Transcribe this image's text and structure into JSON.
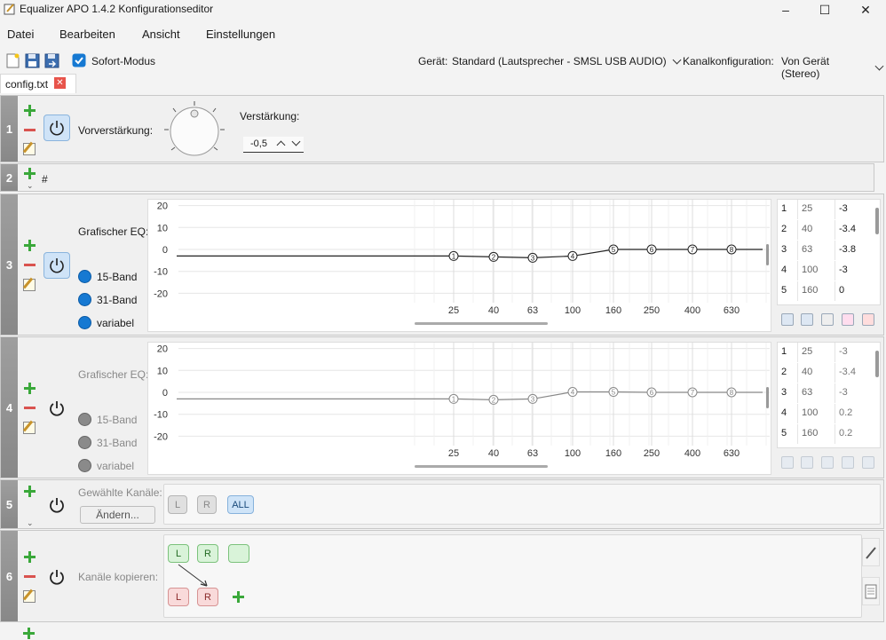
{
  "window": {
    "title": "Equalizer APO 1.4.2 Konfigurationseditor",
    "minimize": "–",
    "maximize": "☐",
    "close": "✕"
  },
  "menu": [
    "Datei",
    "Bearbeiten",
    "Ansicht",
    "Einstellungen"
  ],
  "toolbar": {
    "instant_mode": "Sofort-Modus",
    "device_label": "Gerät:",
    "device_value": "Standard (Lautsprecher - SMSL USB AUDIO)",
    "channel_label": "Kanalkonfiguration:",
    "channel_value": "Von Gerät (Stereo)"
  },
  "tab": {
    "label": "config.txt",
    "close": "✕"
  },
  "rows": {
    "r1": {
      "num": "1",
      "label": "Vorverstärkung:",
      "gain_label": "Verstärkung:",
      "gain_value": "-0,5"
    },
    "r2": {
      "num": "2",
      "text": "#"
    },
    "r3": {
      "num": "3",
      "label": "Grafischer EQ:",
      "opt1": "15-Band",
      "opt2": "31-Band",
      "opt3": "variabel"
    },
    "r4": {
      "num": "4",
      "label": "Grafischer EQ:",
      "opt1": "15-Band",
      "opt2": "31-Band",
      "opt3": "variabel"
    },
    "r5": {
      "num": "5",
      "label": "Gewählte Kanäle:",
      "change": "Ändern...",
      "ch_l": "L",
      "ch_r": "R",
      "ch_all": "ALL"
    },
    "r6": {
      "num": "6",
      "label": "Kanäle kopieren:",
      "src_l": "L",
      "src_r": "R",
      "dst_l": "L",
      "dst_r": "R"
    }
  },
  "eq_axes": {
    "y_ticks": [
      "20",
      "10",
      "0",
      "-10",
      "-20"
    ],
    "x_ticks": [
      "25",
      "40",
      "63",
      "100",
      "160",
      "250",
      "400",
      "630"
    ]
  },
  "eq3": {
    "points": [
      {
        "n": "1",
        "freq": 25,
        "gain": -3
      },
      {
        "n": "2",
        "freq": 40,
        "gain": -3.4
      },
      {
        "n": "3",
        "freq": 63,
        "gain": -3.8
      },
      {
        "n": "4",
        "freq": 100,
        "gain": -3
      },
      {
        "n": "5",
        "freq": 160,
        "gain": 0
      },
      {
        "n": "6",
        "freq": 250,
        "gain": 0
      },
      {
        "n": "7",
        "freq": 400,
        "gain": 0
      },
      {
        "n": "8",
        "freq": 630,
        "gain": 0
      }
    ],
    "table": [
      {
        "n": "1",
        "f": "25",
        "g": "-3"
      },
      {
        "n": "2",
        "f": "40",
        "g": "-3.4"
      },
      {
        "n": "3",
        "f": "63",
        "g": "-3.8"
      },
      {
        "n": "4",
        "f": "100",
        "g": "-3"
      },
      {
        "n": "5",
        "f": "160",
        "g": "0"
      }
    ]
  },
  "eq4": {
    "points": [
      {
        "n": "1",
        "freq": 25,
        "gain": -3
      },
      {
        "n": "2",
        "freq": 40,
        "gain": -3.4
      },
      {
        "n": "3",
        "freq": 63,
        "gain": -3
      },
      {
        "n": "4",
        "freq": 100,
        "gain": 0.2
      },
      {
        "n": "5",
        "freq": 160,
        "gain": 0.2
      },
      {
        "n": "6",
        "freq": 250,
        "gain": 0
      },
      {
        "n": "7",
        "freq": 400,
        "gain": 0
      },
      {
        "n": "8",
        "freq": 630,
        "gain": 0
      }
    ],
    "table": [
      {
        "n": "1",
        "f": "25",
        "g": "-3"
      },
      {
        "n": "2",
        "f": "40",
        "g": "-3.4"
      },
      {
        "n": "3",
        "f": "63",
        "g": "-3"
      },
      {
        "n": "4",
        "f": "100",
        "g": "0.2"
      },
      {
        "n": "5",
        "f": "160",
        "g": "0.2"
      }
    ]
  },
  "colors": {
    "accent": "#1679d2",
    "add": "#3aa83a",
    "remove": "#d9534f"
  }
}
